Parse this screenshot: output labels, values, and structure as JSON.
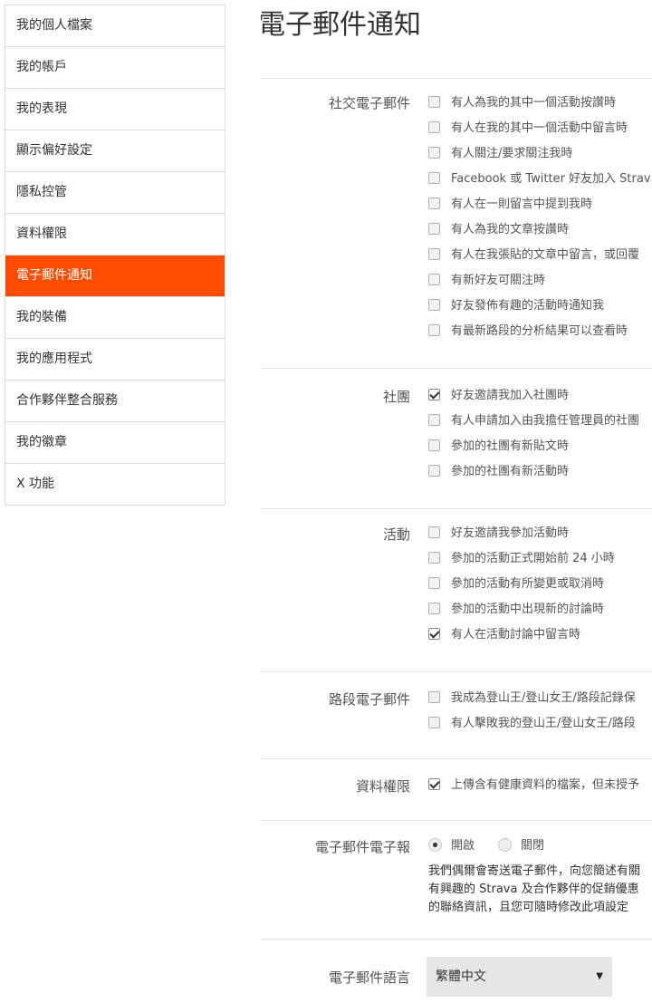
{
  "sidebar": {
    "items": [
      {
        "label": "我的個人檔案",
        "active": false
      },
      {
        "label": "我的帳戶",
        "active": false
      },
      {
        "label": "我的表現",
        "active": false
      },
      {
        "label": "顯示偏好設定",
        "active": false
      },
      {
        "label": "隱私控管",
        "active": false
      },
      {
        "label": "資料權限",
        "active": false
      },
      {
        "label": "電子郵件通知",
        "active": true
      },
      {
        "label": "我的裝備",
        "active": false
      },
      {
        "label": "我的應用程式",
        "active": false
      },
      {
        "label": "合作夥伴整合服務",
        "active": false
      },
      {
        "label": "我的徽章",
        "active": false
      },
      {
        "label": "X 功能",
        "active": false
      }
    ]
  },
  "accent_color": "#fc4c02",
  "main": {
    "title": "電子郵件通知",
    "social": {
      "label": "社交電子郵件",
      "options": [
        {
          "label": "有人為我的其中一個活動按讚時",
          "checked": false
        },
        {
          "label": "有人在我的其中一個活動中留言時",
          "checked": false
        },
        {
          "label": "有人關注/要求關注我時",
          "checked": false
        },
        {
          "label": "Facebook 或 Twitter 好友加入 Strav",
          "checked": false
        },
        {
          "label": "有人在一則留言中提到我時",
          "checked": false
        },
        {
          "label": "有人為我的文章按讚時",
          "checked": false
        },
        {
          "label": "有人在我張貼的文章中留言，或回覆",
          "checked": false
        },
        {
          "label": "有新好友可關注時",
          "checked": false
        },
        {
          "label": "好友發佈有趣的活動時通知我",
          "checked": false
        },
        {
          "label": "有最新路段的分析結果可以查看時",
          "checked": false
        }
      ]
    },
    "clubs": {
      "label": "社團",
      "options": [
        {
          "label": "好友邀請我加入社團時",
          "checked": true
        },
        {
          "label": "有人申請加入由我擔任管理員的社團",
          "checked": false
        },
        {
          "label": "參加的社團有新貼文時",
          "checked": false
        },
        {
          "label": "參加的社團有新活動時",
          "checked": false
        }
      ]
    },
    "events": {
      "label": "活動",
      "options": [
        {
          "label": "好友邀請我參加活動時",
          "checked": false
        },
        {
          "label": "參加的活動正式開始前 24 小時",
          "checked": false
        },
        {
          "label": "參加的活動有所變更或取消時",
          "checked": false
        },
        {
          "label": "參加的活動中出現新的討論時",
          "checked": false
        },
        {
          "label": "有人在活動討論中留言時",
          "checked": true
        }
      ]
    },
    "segments": {
      "label": "路段電子郵件",
      "options": [
        {
          "label": "我成為登山王/登山女王/路段記錄保",
          "checked": false
        },
        {
          "label": "有人擊敗我的登山王/登山女王/路段",
          "checked": false
        }
      ]
    },
    "data_permissions": {
      "label": "資料權限",
      "options": [
        {
          "label": "上傳含有健康資料的檔案，但未授予",
          "checked": true
        }
      ]
    },
    "newsletter": {
      "label": "電子郵件電子報",
      "on_label": "開啟",
      "off_label": "關閉",
      "selected": "開啟",
      "description_lines": [
        "我們偶爾會寄送電子郵件，向您簡述有關",
        "有興趣的 Strava 及合作夥伴的促銷優惠",
        "的聯絡資訊，且您可隨時修改此項設定"
      ]
    },
    "language": {
      "label": "電子郵件語言",
      "selected": "繁體中文"
    }
  }
}
